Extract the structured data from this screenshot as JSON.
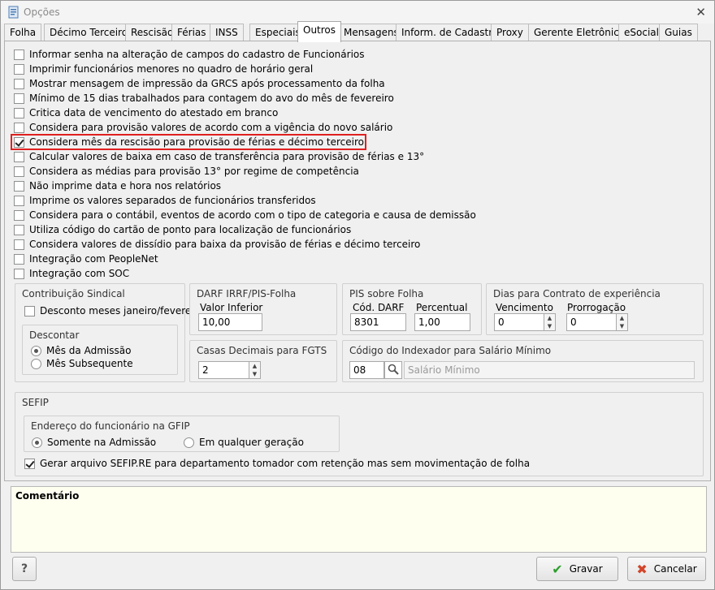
{
  "window": {
    "title": "Opções",
    "close_glyph": "✕"
  },
  "tabs": [
    "Folha",
    "Décimo Terceiro",
    "Rescisão",
    "Férias",
    "INSS",
    "Especiais",
    "Outros",
    "Mensagens",
    "Inform. de Cadastro",
    "Proxy",
    "Gerente Eletrônico",
    "eSocial",
    "Guias"
  ],
  "active_tab": "Outros",
  "options": [
    {
      "label": "Informar senha na alteração de campos do cadastro de Funcionários",
      "checked": false
    },
    {
      "label": "Imprimir funcionários menores no quadro de horário geral",
      "checked": false
    },
    {
      "label": "Mostrar mensagem de impressão da GRCS após processamento da folha",
      "checked": false
    },
    {
      "label": "Mínimo de 15 dias trabalhados para contagem do avo do mês de fevereiro",
      "checked": false
    },
    {
      "label": "Critica data de vencimento do atestado em branco",
      "checked": false
    },
    {
      "label": "Considera para provisão valores de acordo com a vigência do novo salário",
      "checked": false
    },
    {
      "label": "Considera mês da rescisão para provisão de férias e décimo terceiro",
      "checked": true
    },
    {
      "label": "Calcular valores de baixa em caso de transferência para provisão de férias e 13°",
      "checked": false
    },
    {
      "label": "Considera as médias para provisão 13° por regime de competência",
      "checked": false
    },
    {
      "label": "Não imprime data e hora nos relatórios",
      "checked": false
    },
    {
      "label": "Imprime os valores separados de funcionários transferidos",
      "checked": false
    },
    {
      "label": "Considera para o contábil, eventos de acordo com o tipo de categoria e causa de demissão",
      "checked": false
    },
    {
      "label": "Utiliza código do cartão de ponto para localização de funcionários",
      "checked": false
    },
    {
      "label": "Considera valores de dissídio para baixa da provisão de férias e décimo terceiro",
      "checked": false
    },
    {
      "label": "Integração com PeopleNet",
      "checked": false
    },
    {
      "label": "Integração com SOC",
      "checked": false
    }
  ],
  "contribuicao": {
    "title": "Contribuição Sindical",
    "desconto_label": "Desconto meses janeiro/fevereiro",
    "descontar_title": "Descontar",
    "radio1": "Mês da Admissão",
    "radio2": "Mês Subsequente"
  },
  "darf": {
    "title": "DARF IRRF/PIS-Folha",
    "valor_label": "Valor Inferior",
    "valor": "10,00"
  },
  "pis": {
    "title": "PIS sobre Folha",
    "cod_label": "Cód. DARF",
    "cod": "8301",
    "perc_label": "Percentual",
    "perc": "1,00"
  },
  "contrato": {
    "title": "Dias para Contrato de experiência",
    "venc_label": "Vencimento",
    "venc": "0",
    "prorr_label": "Prorrogação",
    "prorr": "0"
  },
  "fgts": {
    "title": "Casas Decimais para FGTS",
    "value": "2"
  },
  "indexador": {
    "title": "Código do Indexador para Salário Mínimo",
    "code": "08",
    "desc": "Salário Mínimo"
  },
  "sefip": {
    "title": "SEFIP",
    "endereco_title": "Endereço do funcionário na GFIP",
    "radio1": "Somente na Admissão",
    "radio2": "Em qualquer geração",
    "gerar_label": "Gerar arquivo SEFIP.RE para departamento tomador com retenção mas sem movimentação de folha"
  },
  "comment": {
    "title": "Comentário"
  },
  "buttons": {
    "help": "?",
    "save": "Gravar",
    "cancel": "Cancelar"
  }
}
